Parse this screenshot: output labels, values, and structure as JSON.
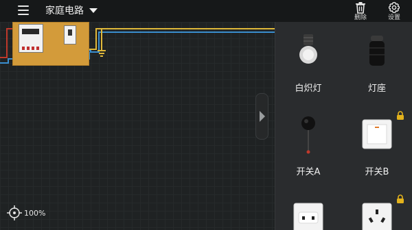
{
  "header": {
    "title": "家庭电路",
    "delete_label": "删除",
    "settings_label": "设置"
  },
  "canvas": {
    "zoom_level": "100%"
  },
  "panel": {
    "items": [
      {
        "label": "白炽灯",
        "icon": "incandescent-bulb-icon",
        "locked": false
      },
      {
        "label": "灯座",
        "icon": "lamp-holder-icon",
        "locked": false
      },
      {
        "label": "开关A",
        "icon": "switch-a-icon",
        "locked": false
      },
      {
        "label": "开关B",
        "icon": "switch-b-icon",
        "locked": true
      },
      {
        "label": "",
        "icon": "two-pin-socket-icon",
        "locked": false
      },
      {
        "label": "",
        "icon": "three-pin-socket-icon",
        "locked": true
      }
    ]
  },
  "colors": {
    "wire_red": "#c0392b",
    "wire_blue": "#3a8fd0",
    "wire_yellow": "#e0b93a",
    "lock_gold": "#e3b21c"
  }
}
